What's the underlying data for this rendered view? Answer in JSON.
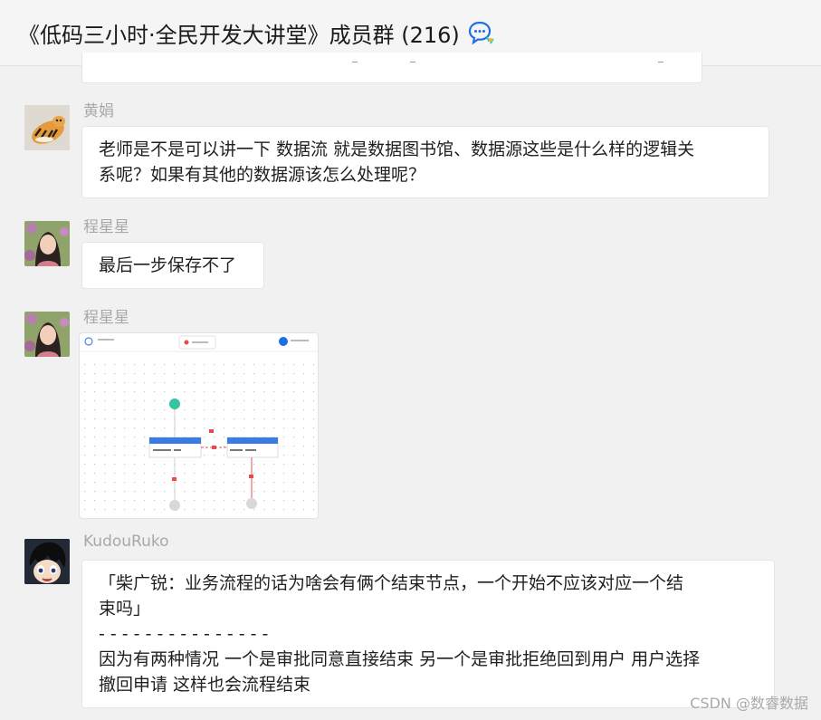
{
  "header": {
    "title": "《低码三小时·全民开发大讲堂》成员群 (216)",
    "icon": "chat-bubble-icon"
  },
  "messages": [
    {
      "sender": "黄娟",
      "avatar": "tiger-avatar",
      "lines": [
        "老师是不是可以讲一下 数据流 就是数据图书馆、数据源这些是什么样的逻辑关",
        "系呢？如果有其他的数据源该怎么处理呢？"
      ]
    },
    {
      "sender": "程星星",
      "avatar": "girl-avatar",
      "lines": [
        "最后一步保存不了"
      ]
    },
    {
      "sender": "程星星",
      "avatar": "girl-avatar",
      "image": "workflow-screenshot"
    },
    {
      "sender": "KudouRuko",
      "avatar": "anime-avatar",
      "lines": [
        "「柴广锐：业务流程的话为啥会有俩个结束节点，一个开始不应该对应一个结",
        "束吗」",
        "- - - - - - - - - - - - - - -",
        "因为有两种情况 一个是审批同意直接结束 另一个是审批拒绝回到用户 用户选择",
        "撤回申请 这样也会流程结束"
      ]
    }
  ],
  "watermark": "CSDN @数睿数据",
  "colors": {
    "background": "#f1f1f1",
    "bubble": "#ffffff",
    "accent": "#1e6ee8"
  }
}
